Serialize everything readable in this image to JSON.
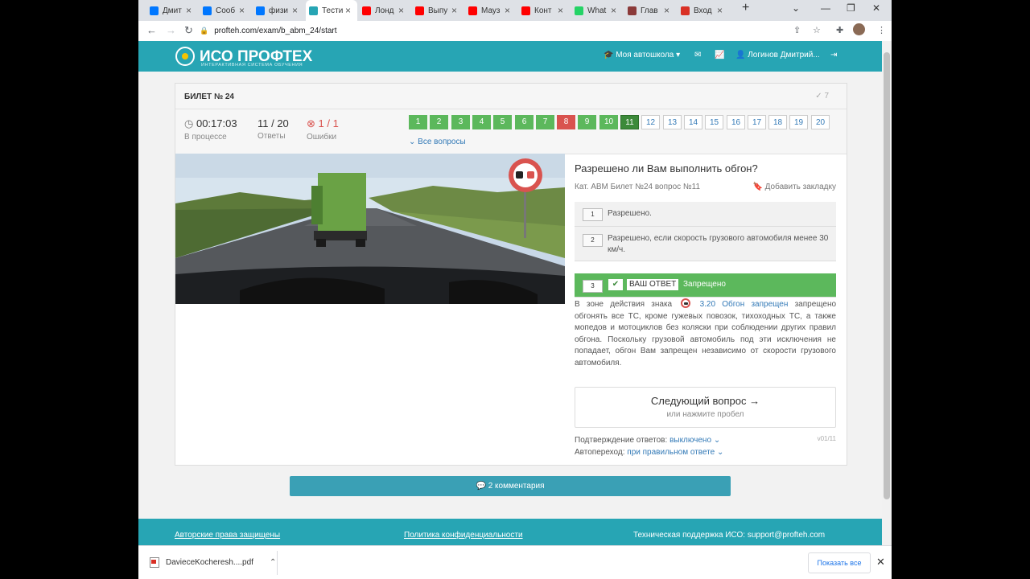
{
  "browser": {
    "tabs": [
      {
        "title": "Дмит",
        "icon": "vk-icon",
        "color": "#0077ff"
      },
      {
        "title": "Сооб",
        "icon": "vk-messages-icon",
        "color": "#0077ff"
      },
      {
        "title": "физи",
        "icon": "vk-icon",
        "color": "#0077ff"
      },
      {
        "title": "Тести",
        "icon": "profteh-icon",
        "color": "#27a5b4"
      },
      {
        "title": "Лонд",
        "icon": "youtube-icon",
        "color": "#ff0000"
      },
      {
        "title": "Выпу",
        "icon": "youtube-icon",
        "color": "#ff0000"
      },
      {
        "title": "Мауз",
        "icon": "youtube-icon",
        "color": "#ff0000"
      },
      {
        "title": "Конт",
        "icon": "youtube-icon",
        "color": "#ff0000"
      },
      {
        "title": "What",
        "icon": "whatsapp-icon",
        "color": "#25d366"
      },
      {
        "title": "Глав",
        "icon": "site-icon",
        "color": "#8b3a3a"
      },
      {
        "title": "Вход",
        "icon": "gmail-icon",
        "color": "#d93025"
      }
    ],
    "url": "profteh.com/exam/b_abm_24/start"
  },
  "nav": {
    "logo_name": "ИСО ПРОФТЕХ",
    "logo_sub": "ИНТЕРАКТИВНАЯ СИСТЕМА ОБУЧЕНИЯ",
    "school": "Моя автошкола",
    "user": "Логинов Дмитрий..."
  },
  "ticket": {
    "title": "БИЛЕТ № 24",
    "check_count": "7",
    "timer": "00:17:03",
    "timer_label": "В процессе",
    "answers": "11 / 20",
    "answers_label": "Ответы",
    "errors": "1 / 1",
    "errors_label": "Ошибки",
    "questions": [
      {
        "n": "1",
        "state": "correct"
      },
      {
        "n": "2",
        "state": "correct"
      },
      {
        "n": "3",
        "state": "correct"
      },
      {
        "n": "4",
        "state": "correct"
      },
      {
        "n": "5",
        "state": "correct"
      },
      {
        "n": "6",
        "state": "correct"
      },
      {
        "n": "7",
        "state": "correct"
      },
      {
        "n": "8",
        "state": "wrong"
      },
      {
        "n": "9",
        "state": "correct"
      },
      {
        "n": "10",
        "state": "correct"
      },
      {
        "n": "11",
        "state": "current"
      },
      {
        "n": "12",
        "state": "empty"
      },
      {
        "n": "13",
        "state": "empty"
      },
      {
        "n": "14",
        "state": "empty"
      },
      {
        "n": "15",
        "state": "empty"
      },
      {
        "n": "16",
        "state": "empty"
      },
      {
        "n": "17",
        "state": "empty"
      },
      {
        "n": "18",
        "state": "empty"
      },
      {
        "n": "19",
        "state": "empty"
      },
      {
        "n": "20",
        "state": "empty"
      }
    ],
    "all_questions": "Все вопросы"
  },
  "question": {
    "title": "Разрешено ли Вам выполнить обгон?",
    "meta": "Кат. ABM   Билет №24  вопрос №11",
    "bookmark": "Добавить закладку",
    "answers": [
      {
        "n": "1",
        "text": "Разрешено."
      },
      {
        "n": "2",
        "text": "Разрешено, если скорость грузового автомобиля менее 30 км/ч."
      },
      {
        "n": "3",
        "text": "Запрещено",
        "your": "ВАШ ОТВЕТ"
      }
    ],
    "explanation_pre": "В зоне действия знака",
    "sign_link": "3.20 Обгон запрещен",
    "explanation_post": "запрещено обгонять все ТС, кроме гужевых повозок, тихоходных ТС, а также мопедов и мотоциклов без коляски при соблюдении других правил обгона. Поскольку грузовой автомобиль под эти исключения не попадает, обгон Вам запрещен независимо от скорости грузового автомобиля.",
    "next": "Следующий вопрос →",
    "next_hint": "или нажмите пробел",
    "confirm_label": "Подтверждение ответов:",
    "confirm_value": "выключено",
    "auto_label": "Автопереход:",
    "auto_value": "при правильном ответе",
    "version": "v01/11"
  },
  "comments": "2 комментария",
  "footer": {
    "copyright": "Авторские права защищены",
    "privacy": "Политика конфиденциальности",
    "support": "Техническая поддержка ИСО:  support@profteh.com"
  },
  "download": {
    "file": "DavieceKocheresh....pdf",
    "show_all": "Показать все"
  }
}
